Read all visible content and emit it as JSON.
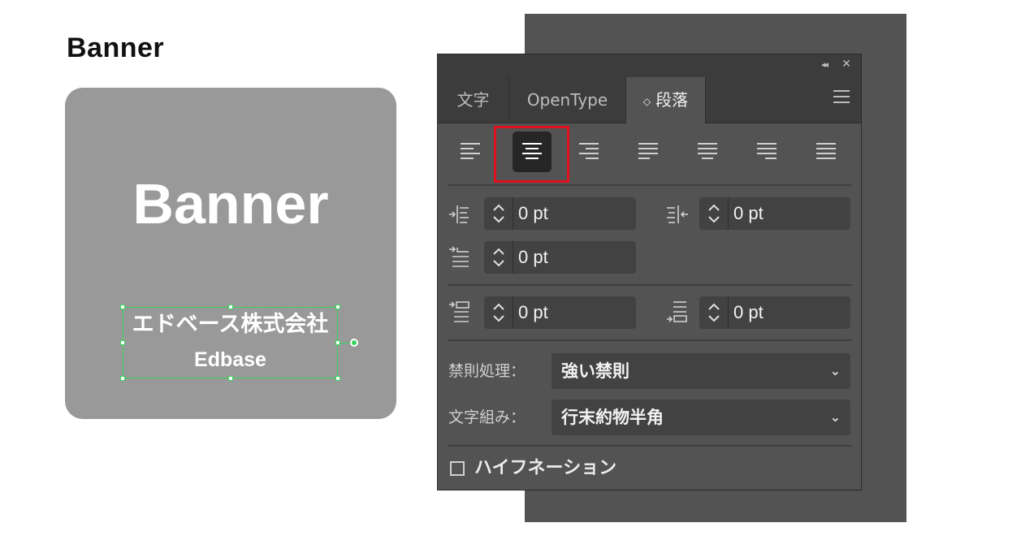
{
  "page": {
    "title": "Banner"
  },
  "banner": {
    "heading": "Banner",
    "company_jp": "エドベース株式会社",
    "company_en": "Edbase",
    "selection_color": "#37d35b"
  },
  "panel": {
    "tabs": [
      {
        "label": "文字",
        "active": false
      },
      {
        "label": "OpenType",
        "active": false
      },
      {
        "label": "段落",
        "active": true
      }
    ],
    "alignment": {
      "buttons": [
        "align-left",
        "align-center",
        "align-right",
        "justify-last-left",
        "justify-last-center",
        "justify-last-right",
        "justify-all"
      ],
      "selected": "align-center",
      "highlight_color": "#e0101e"
    },
    "indents": {
      "left_indent": "0 pt",
      "right_indent": "0 pt",
      "first_line_indent": "0 pt"
    },
    "spacing": {
      "space_before": "0 pt",
      "space_after": "0 pt"
    },
    "kinsoku": {
      "label": "禁則処理：",
      "value": "強い禁則"
    },
    "mojikumi": {
      "label": "文字組み：",
      "value": "行末約物半角"
    },
    "hyphenation": {
      "label": "ハイフネーション",
      "checked": false
    },
    "colors": {
      "panel_bg": "#535353",
      "field_bg": "#424242",
      "tab_bg": "#3c3c3c"
    }
  }
}
